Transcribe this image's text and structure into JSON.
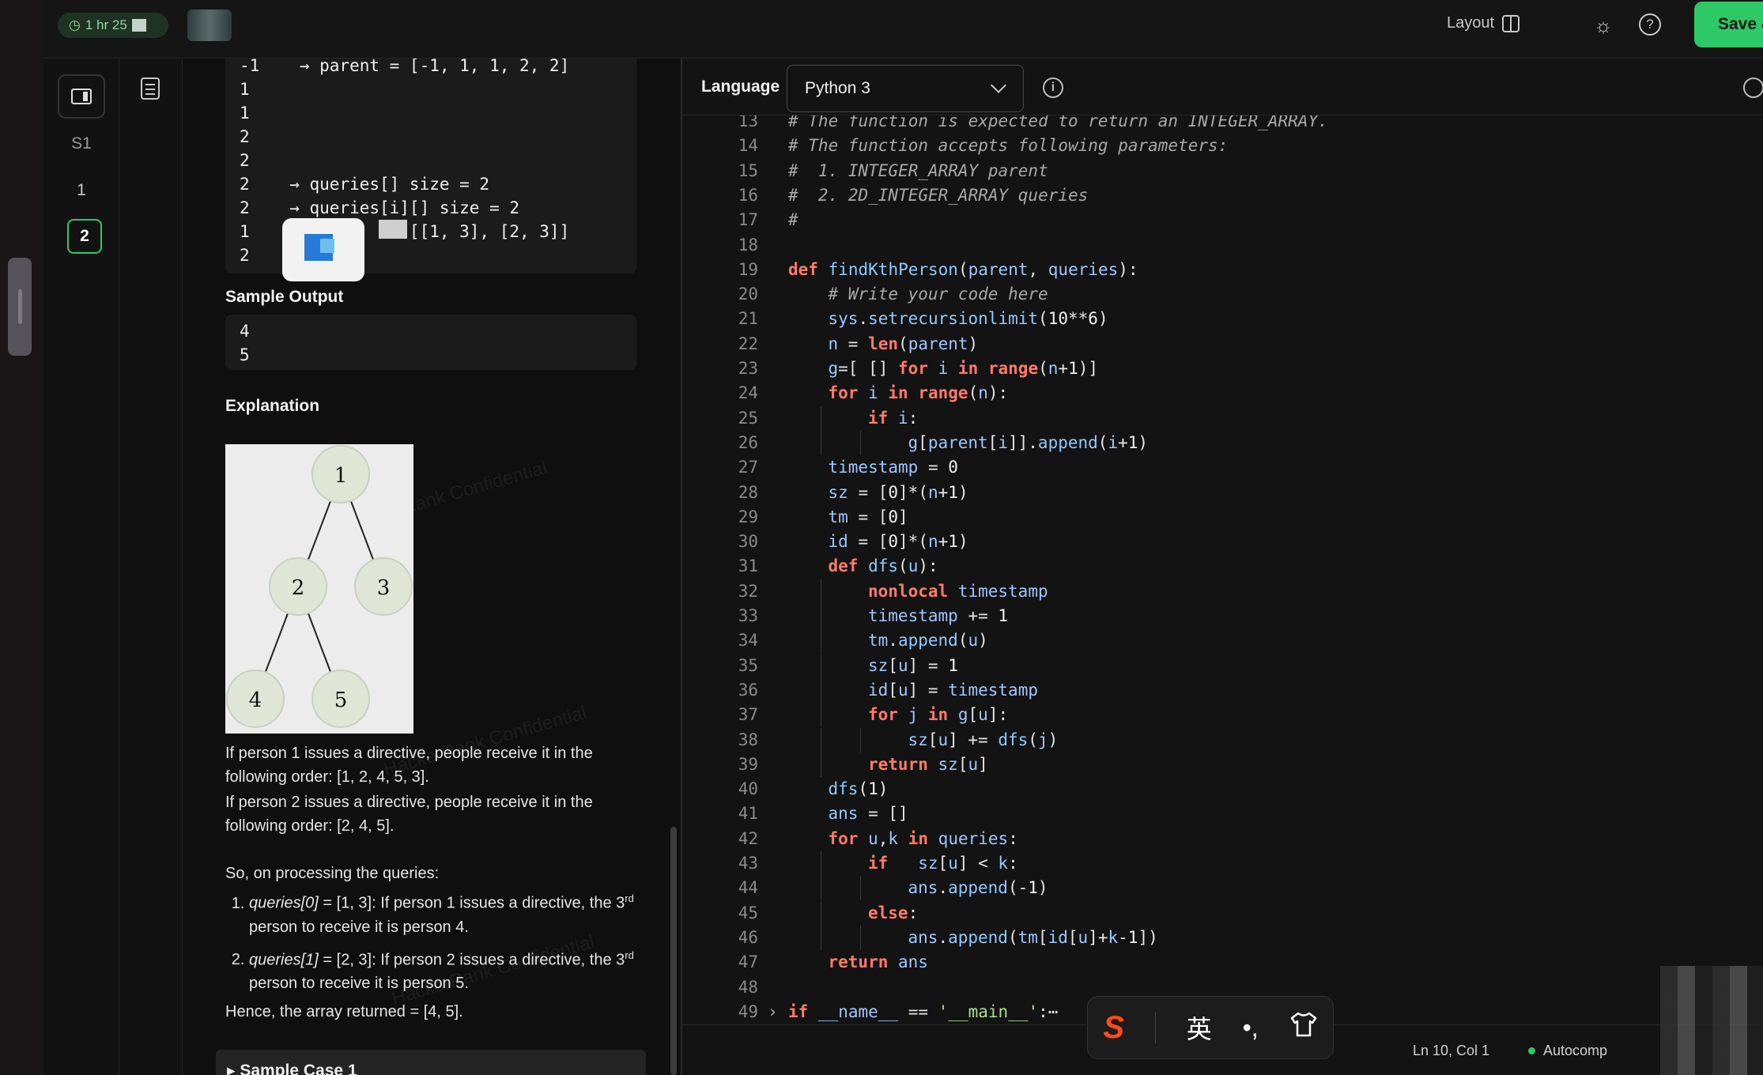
{
  "topbar": {
    "timer": "1 hr 25",
    "layout_label": "Layout",
    "save_label": "Save & Proc"
  },
  "rail": {
    "items": [
      "S1",
      "1",
      "2"
    ],
    "active": "2"
  },
  "problem": {
    "input_lines": [
      "-1    → parent = [-1, 1, 1, 2, 2]",
      "1",
      "1",
      "2",
      "2",
      "2    → queries[] size = 2",
      "2    → queries[i][] size = 2",
      "1                [[1, 3], [2, 3]]",
      "2"
    ],
    "sample_output_heading": "Sample Output",
    "sample_output_lines": [
      "4",
      "5"
    ],
    "explanation_heading": "Explanation",
    "tree_nodes": [
      "1",
      "2",
      "3",
      "4",
      "5"
    ],
    "para1": "If person 1 issues a directive, people receive it in the following order: [1, 2, 4, 5, 3].",
    "para2": "If person 2 issues a directive, people receive it in the following order: [2, 4, 5].",
    "para3": "So, on processing the queries:",
    "q1_label": "queries[0]",
    "q1_rest": " = [1, 3]:  If person 1 issues a directive, the 3",
    "q1_sup": "rd",
    "q1_tail": " person to receive it is person 4.",
    "q2_label": "queries[1]",
    "q2_rest": " = [2, 3]:  If person 2 issues a directive, the 3",
    "q2_sup": "rd",
    "q2_tail": " person to receive it is person 5.",
    "hence": "Hence, the array returned = [4, 5].",
    "sample_case": "▸ Sample Case 1",
    "watermark": "HackerRank Confidential"
  },
  "editor": {
    "language_label": "Language",
    "language_value": "Python 3",
    "lines": [
      {
        "n": "13",
        "i": 0,
        "t": "# The function is expected to return an INTEGER_ARRAY."
      },
      {
        "n": "14",
        "i": 0,
        "t": "# The function accepts following parameters:"
      },
      {
        "n": "15",
        "i": 0,
        "t": "#  1. INTEGER_ARRAY parent"
      },
      {
        "n": "16",
        "i": 0,
        "t": "#  2. 2D_INTEGER_ARRAY queries"
      },
      {
        "n": "17",
        "i": 0,
        "t": "#"
      },
      {
        "n": "18",
        "i": 0,
        "t": ""
      },
      {
        "n": "19",
        "i": 0,
        "t": "def findKthPerson(parent, queries):"
      },
      {
        "n": "20",
        "i": 1,
        "t": "# Write your code here"
      },
      {
        "n": "21",
        "i": 1,
        "t": "sys.setrecursionlimit(10**6)"
      },
      {
        "n": "22",
        "i": 1,
        "t": "n = len(parent)"
      },
      {
        "n": "23",
        "i": 1,
        "t": "g=[ [] for i in range(n+1)]"
      },
      {
        "n": "24",
        "i": 1,
        "t": "for i in range(n):"
      },
      {
        "n": "25",
        "i": 2,
        "t": "if i:"
      },
      {
        "n": "26",
        "i": 3,
        "t": "g[parent[i]].append(i+1)"
      },
      {
        "n": "27",
        "i": 1,
        "t": "timestamp = 0"
      },
      {
        "n": "28",
        "i": 1,
        "t": "sz = [0]*(n+1)"
      },
      {
        "n": "29",
        "i": 1,
        "t": "tm = [0]"
      },
      {
        "n": "30",
        "i": 1,
        "t": "id = [0]*(n+1)"
      },
      {
        "n": "31",
        "i": 1,
        "t": "def dfs(u):"
      },
      {
        "n": "32",
        "i": 2,
        "t": "nonlocal timestamp"
      },
      {
        "n": "33",
        "i": 2,
        "t": "timestamp += 1"
      },
      {
        "n": "34",
        "i": 2,
        "t": "tm.append(u)"
      },
      {
        "n": "35",
        "i": 2,
        "t": "sz[u] = 1"
      },
      {
        "n": "36",
        "i": 2,
        "t": "id[u] = timestamp"
      },
      {
        "n": "37",
        "i": 2,
        "t": "for j in g[u]:"
      },
      {
        "n": "38",
        "i": 3,
        "t": "sz[u] += dfs(j)"
      },
      {
        "n": "39",
        "i": 2,
        "t": "return sz[u]"
      },
      {
        "n": "40",
        "i": 1,
        "t": "dfs(1)"
      },
      {
        "n": "41",
        "i": 1,
        "t": "ans = []"
      },
      {
        "n": "42",
        "i": 1,
        "t": "for u,k in queries:"
      },
      {
        "n": "43",
        "i": 2,
        "t": "if   sz[u] < k:"
      },
      {
        "n": "44",
        "i": 3,
        "t": "ans.append(-1)"
      },
      {
        "n": "45",
        "i": 2,
        "t": "else:"
      },
      {
        "n": "46",
        "i": 3,
        "t": "ans.append(tm[id[u]+k-1])"
      },
      {
        "n": "47",
        "i": 1,
        "t": "return ans"
      },
      {
        "n": "48",
        "i": 0,
        "t": ""
      },
      {
        "n": "49",
        "i": 0,
        "t": "if __name__ == '__main__':⋯"
      }
    ],
    "status_position": "Ln 10, Col 1",
    "status_autocomplete": "Autocomp"
  },
  "ime": {
    "logo": "S",
    "mode": "英",
    "punct": "•,",
    "skin_icon": "shirt-icon"
  },
  "colors": {
    "accent_green": "#2ec866",
    "keyword": "#ff7a6b",
    "function": "#8ecbff"
  }
}
